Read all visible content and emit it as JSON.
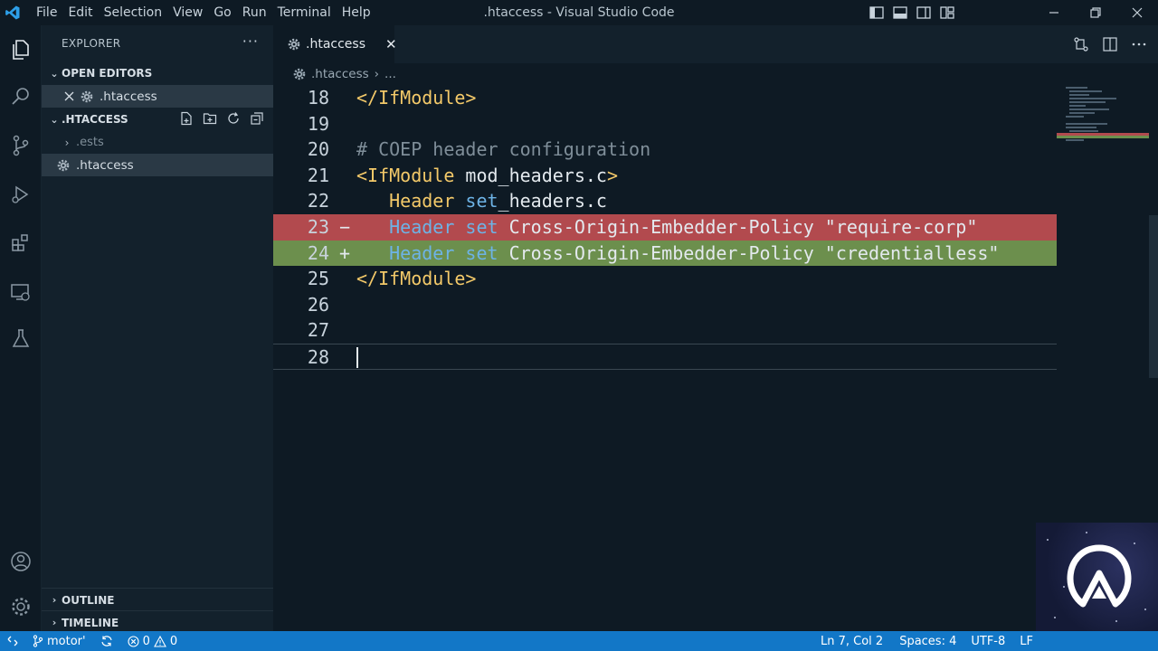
{
  "titlebar": {
    "title": ".htaccess - Visual Studio Code",
    "menu": [
      "File",
      "Edit",
      "Selection",
      "View",
      "Go",
      "Run",
      "Terminal",
      "Help"
    ]
  },
  "sidebar": {
    "header": "EXPLORER",
    "more": "···",
    "open_editors": {
      "label": "OPEN EDITORS",
      "items": [
        {
          "label": ".htaccess"
        }
      ]
    },
    "workspace": {
      "label": ".HTACCESS",
      "items": [
        {
          "label": ".ests"
        },
        {
          "label": ".htaccess"
        }
      ]
    },
    "outline": "OUTLINE",
    "timeline": "TIMELINE"
  },
  "tab": {
    "label": ".htaccess",
    "close": "✕"
  },
  "breadcrumb": {
    "file": ".htaccess",
    "rest": "..."
  },
  "editor": {
    "lines": [
      {
        "ln": "18",
        "marker": "",
        "type": "normal",
        "tokens": [
          {
            "t": "tag",
            "v": "</IfModule>"
          }
        ]
      },
      {
        "ln": "19",
        "marker": "",
        "type": "normal",
        "tokens": []
      },
      {
        "ln": "20",
        "marker": "",
        "type": "normal",
        "tokens": [
          {
            "t": "comment",
            "v": "# COEP header configuration"
          }
        ]
      },
      {
        "ln": "21",
        "marker": "",
        "type": "normal",
        "tokens": [
          {
            "t": "tag",
            "v": "<IfModule"
          },
          {
            "t": "plain",
            "v": " mod_headers.c"
          },
          {
            "t": "tag",
            "v": ">"
          }
        ]
      },
      {
        "ln": "22",
        "marker": "",
        "type": "normal",
        "tokens": [
          {
            "t": "plain",
            "v": "   "
          },
          {
            "t": "key",
            "v": "Header"
          },
          {
            "t": "plain",
            "v": " "
          },
          {
            "t": "kw",
            "v": "set"
          },
          {
            "t": "plain",
            "v": "_headers.c"
          }
        ]
      },
      {
        "ln": "23",
        "marker": "−",
        "type": "del",
        "tokens": [
          {
            "t": "plain",
            "v": "   "
          },
          {
            "t": "kw",
            "v": "Header"
          },
          {
            "t": "plain",
            "v": " "
          },
          {
            "t": "kw",
            "v": "set"
          },
          {
            "t": "plain",
            "v": " Cross-Origin-Embedder-Policy "
          },
          {
            "t": "str",
            "v": "\"require-corp\""
          }
        ]
      },
      {
        "ln": "24",
        "marker": "+",
        "type": "ins",
        "tokens": [
          {
            "t": "plain",
            "v": "   "
          },
          {
            "t": "kw",
            "v": "Header"
          },
          {
            "t": "plain",
            "v": " "
          },
          {
            "t": "kw",
            "v": "set"
          },
          {
            "t": "plain",
            "v": " Cross-Origin-Embedder-Policy "
          },
          {
            "t": "str",
            "v": "\"credentialless\""
          }
        ]
      },
      {
        "ln": "25",
        "marker": "",
        "type": "normal",
        "tokens": [
          {
            "t": "tag",
            "v": "</IfModule>"
          }
        ]
      },
      {
        "ln": "26",
        "marker": "",
        "type": "normal",
        "tokens": []
      },
      {
        "ln": "27",
        "marker": "",
        "type": "normal",
        "tokens": []
      },
      {
        "ln": "28",
        "marker": "",
        "type": "current",
        "tokens": []
      }
    ]
  },
  "statusbar": {
    "branch": "motor'",
    "errors": "0",
    "warnings": "0",
    "position": "Ln 7, Col 2",
    "spaces": "Spaces: 4",
    "encoding": "UTF-8",
    "eol": "LF"
  },
  "colors": {
    "accent": "#1277c7",
    "diff_delete": "#b24a4e",
    "diff_insert": "#6c8f4d",
    "background": "#0e1a24"
  }
}
